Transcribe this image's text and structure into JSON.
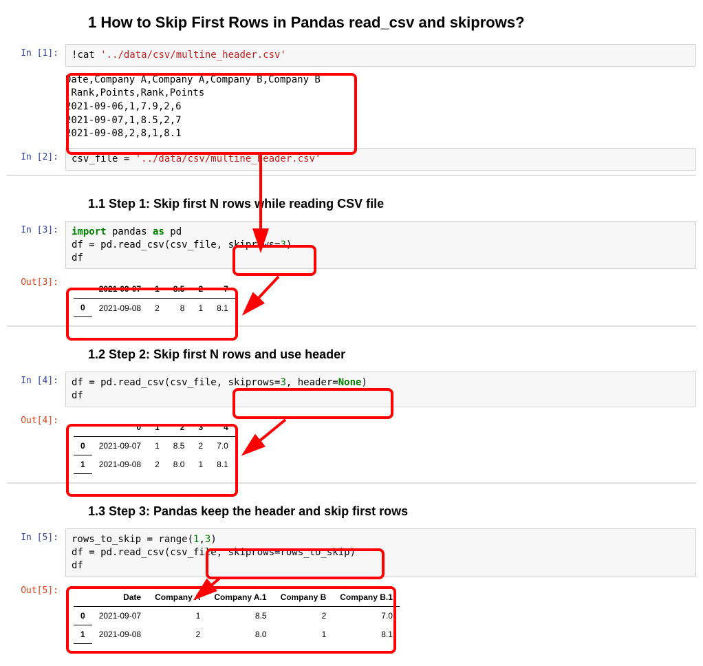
{
  "h1": "1  How to Skip First Rows in Pandas read_csv and skiprows?",
  "h2a": "1.1  Step 1: Skip first N rows while reading CSV file",
  "h2b": "1.2  Step 2: Skip first N rows and use header",
  "h2c": "1.3  Step 3: Pandas keep the header and skip first rows",
  "prompts": {
    "in1": "In [1]:",
    "in2": "In [2]:",
    "in3": "In [3]:",
    "in4": "In [4]:",
    "in5": "In [5]:",
    "out3": "Out[3]:",
    "out4": "Out[4]:",
    "out5": "Out[5]:"
  },
  "code1": {
    "bang": "!",
    "cmd": "cat ",
    "arg": "'../data/csv/multine_header.csv'"
  },
  "output1": "Date,Company A,Company A,Company B,Company B\n,Rank,Points,Rank,Points\n2021-09-06,1,7.9,2,6\n2021-09-07,1,8.5,2,7\n2021-09-08,2,8,1,8.1",
  "code2": {
    "var": "csv_file ",
    "eq": "= ",
    "str": "'../data/csv/multine_header.csv'"
  },
  "code3": {
    "l1_import": "import",
    "l1_mid": " pandas ",
    "l1_as": "as",
    "l1_pd": " pd",
    "l2_pre": "df = pd.read_csv(csv_file, skiprows=",
    "l2_num": "3",
    "l2_post": ")",
    "l3": "df"
  },
  "table3": {
    "headers": [
      "",
      "2021-09-07",
      "1",
      "8.5",
      "2",
      "7"
    ],
    "rows": [
      [
        "0",
        "2021-09-08",
        "2",
        "8",
        "1",
        "8.1"
      ]
    ]
  },
  "code4": {
    "l1_pre": "df = pd.read_csv(csv_file, skiprows=",
    "l1_num": "3",
    "l1_mid": ", header=",
    "l1_none": "None",
    "l1_post": ")",
    "l2": "df"
  },
  "table4": {
    "headers": [
      "",
      "0",
      "1",
      "2",
      "3",
      "4"
    ],
    "rows": [
      [
        "0",
        "2021-09-07",
        "1",
        "8.5",
        "2",
        "7.0"
      ],
      [
        "1",
        "2021-09-08",
        "2",
        "8.0",
        "1",
        "8.1"
      ]
    ]
  },
  "code5": {
    "l1_pre": "rows_to_skip = range(",
    "l1_n1": "1",
    "l1_c": ",",
    "l1_n2": "3",
    "l1_post": ")",
    "l2": "df = pd.read_csv(csv_file, skiprows=rows_to_skip)",
    "l3": "df"
  },
  "table5": {
    "headers": [
      "",
      "Date",
      "Company A",
      "Company A.1",
      "Company B",
      "Company B.1"
    ],
    "rows": [
      [
        "0",
        "2021-09-07",
        "1",
        "8.5",
        "2",
        "7.0"
      ],
      [
        "1",
        "2021-09-08",
        "2",
        "8.0",
        "1",
        "8.1"
      ]
    ]
  }
}
